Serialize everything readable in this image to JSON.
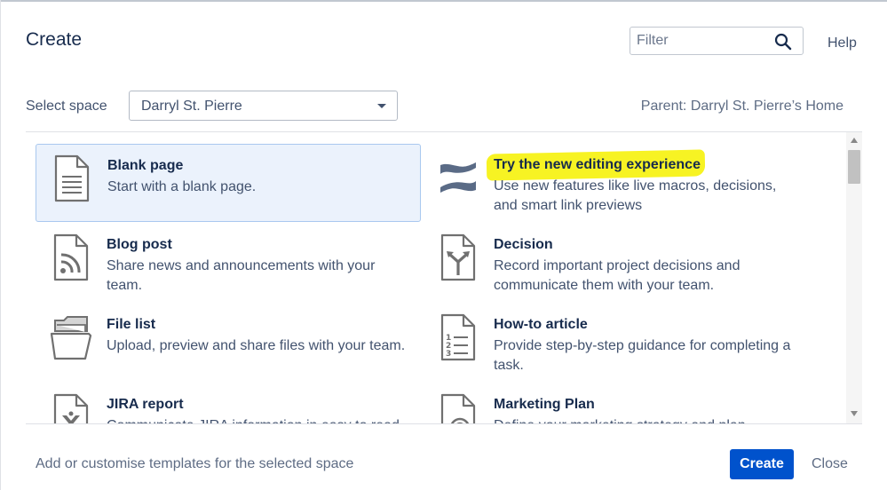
{
  "dialog": {
    "title": "Create",
    "help_label": "Help"
  },
  "filter": {
    "placeholder": "Filter",
    "value": ""
  },
  "space": {
    "label": "Select space",
    "selected": "Darryl St. Pierre"
  },
  "parent": {
    "text": "Parent: Darryl St. Pierre’s Home"
  },
  "templates": [
    {
      "name": "Blank page",
      "description": "Start with a blank page.",
      "icon": "blank-page-icon",
      "selected": true
    },
    {
      "name": "Try the new editing experience",
      "description": "Use new features like live macros, decisions, and smart link previews",
      "icon": "confluence-logo-icon",
      "highlighted": true
    },
    {
      "name": "Blog post",
      "description": "Share news and announcements with your team.",
      "icon": "blog-post-icon"
    },
    {
      "name": "Decision",
      "description": "Record important project decisions and communicate them with your team.",
      "icon": "decision-icon"
    },
    {
      "name": "File list",
      "description": "Upload, preview and share files with your team.",
      "icon": "folder-icon"
    },
    {
      "name": "How-to article",
      "description": "Provide step-by-step guidance for completing a task.",
      "icon": "numbered-list-icon"
    },
    {
      "name": "JIRA report",
      "description": "Communicate JIRA information in easy to read",
      "icon": "jira-report-icon"
    },
    {
      "name": "Marketing Plan",
      "description": "Define your marketing strategy and plan",
      "icon": "marketing-plan-icon"
    }
  ],
  "footer": {
    "customise_link": "Add or customise templates for the selected space",
    "create_label": "Create",
    "close_label": "Close"
  },
  "colors": {
    "primary": "#0052cc",
    "selected_bg": "#ebf2fc",
    "selected_border": "#a9c8ef",
    "highlight": "#f7f323"
  }
}
